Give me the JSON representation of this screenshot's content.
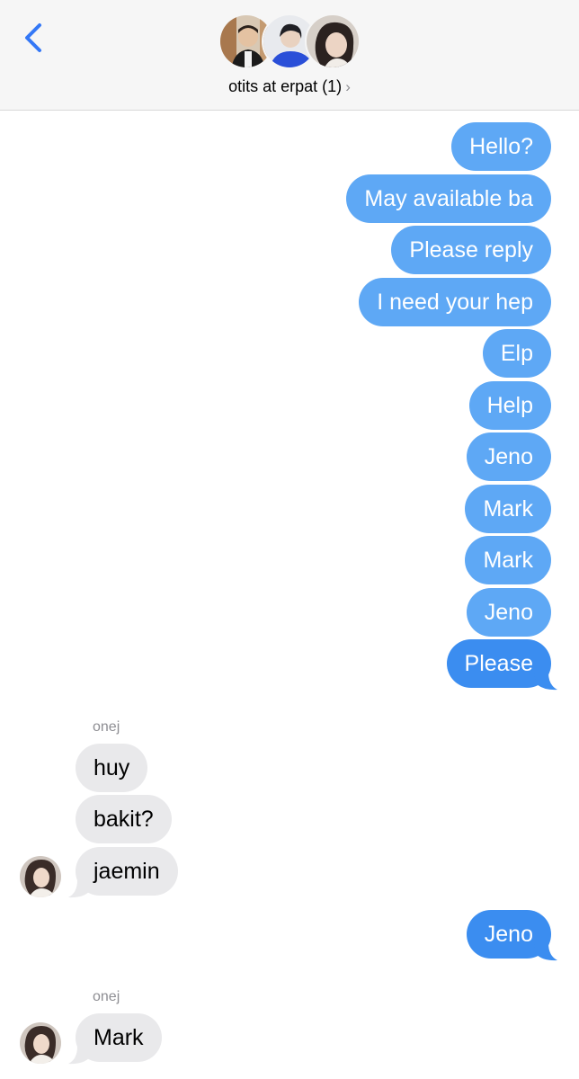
{
  "header": {
    "title": "otits at erpat (1)",
    "chevron": "›",
    "back_icon": "chevron-left-icon"
  },
  "colors": {
    "outgoing_bubble": "#5ea8f5",
    "outgoing_bubble_last": "#3b8df0",
    "incoming_bubble": "#e9e9eb",
    "accent": "#3478f6"
  },
  "messages": {
    "out1": [
      "Hello?",
      "May available ba",
      "Please reply",
      "I need your hep",
      "Elp",
      "Help",
      "Jeno",
      "Mark",
      "Mark",
      "Jeno",
      "Please"
    ],
    "group1_sender": "onej",
    "in1": [
      "huy",
      "bakit?",
      "jaemin"
    ],
    "out2": [
      "Jeno"
    ],
    "group2_sender": "onej",
    "in2": [
      "Mark"
    ]
  }
}
